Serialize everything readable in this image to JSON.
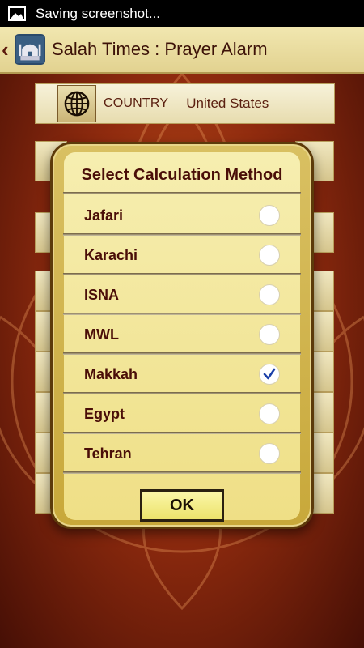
{
  "status_bar": {
    "notification_icon": "image-icon",
    "text": "Saving screenshot..."
  },
  "action_bar": {
    "back_icon": "chevron-left-icon",
    "logo_icon": "mosque-icon",
    "title": "Salah Times : Prayer Alarm"
  },
  "settings": {
    "country_icon": "globe-icon",
    "country_label": "COUNTRY",
    "country_value": "United States"
  },
  "dialog": {
    "title": "Select Calculation Method",
    "options": [
      {
        "label": "Jafari",
        "selected": false
      },
      {
        "label": "Karachi",
        "selected": false
      },
      {
        "label": "ISNA",
        "selected": false
      },
      {
        "label": "MWL",
        "selected": false
      },
      {
        "label": "Makkah",
        "selected": true
      },
      {
        "label": "Egypt",
        "selected": false
      },
      {
        "label": "Tehran",
        "selected": false
      }
    ],
    "ok_label": "OK"
  },
  "colors": {
    "title_text": "#4a0e08",
    "dialog_gold": "#d9c062",
    "check_blue": "#1a3fa8"
  }
}
